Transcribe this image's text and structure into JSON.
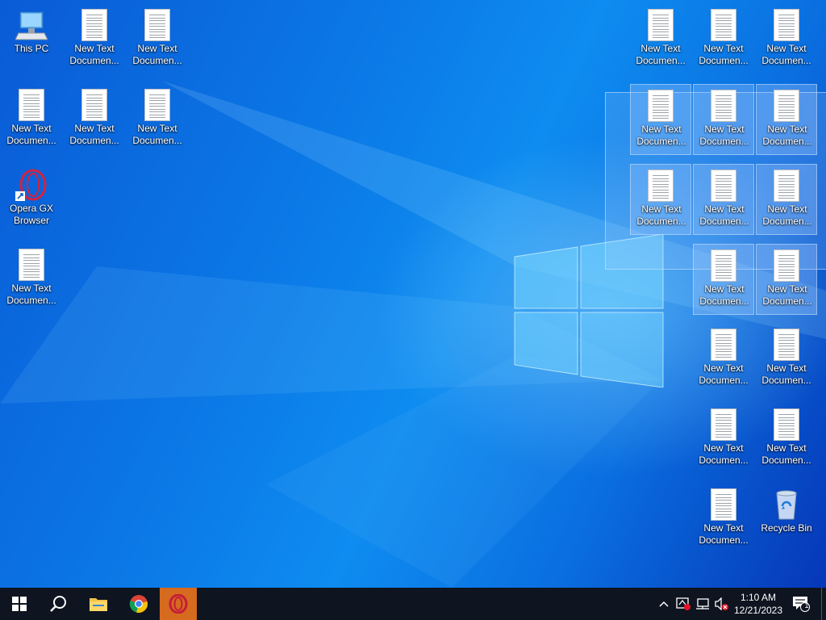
{
  "desktop": {
    "icons": [
      {
        "id": "this-pc",
        "label": "This PC",
        "type": "pc",
        "selected": false
      },
      {
        "id": "doc-1",
        "label": "New Text\nDocumen...",
        "type": "doc",
        "selected": false
      },
      {
        "id": "doc-2",
        "label": "New Text\nDocumen...",
        "type": "doc",
        "selected": false
      },
      {
        "id": "doc-3",
        "label": "New Text\nDocumen...",
        "type": "doc",
        "selected": false
      },
      {
        "id": "doc-4",
        "label": "New Text\nDocumen...",
        "type": "doc",
        "selected": false
      },
      {
        "id": "doc-5",
        "label": "New Text\nDocumen...",
        "type": "doc",
        "selected": false
      },
      {
        "id": "opera-gx",
        "label": "Opera GX\nBrowser",
        "type": "opera",
        "selected": false
      },
      {
        "id": "doc-6",
        "label": "New Text\nDocumen...",
        "type": "doc",
        "selected": false
      },
      {
        "id": "doc-r1",
        "label": "New Text\nDocumen...",
        "type": "doc",
        "selected": false
      },
      {
        "id": "doc-r2",
        "label": "New Text\nDocumen...",
        "type": "doc",
        "selected": false
      },
      {
        "id": "doc-r3",
        "label": "New Text\nDocumen...",
        "type": "doc",
        "selected": false
      },
      {
        "id": "doc-r4",
        "label": "New Text\nDocumen...",
        "type": "doc",
        "selected": true
      },
      {
        "id": "doc-r5",
        "label": "New Text\nDocumen...",
        "type": "doc",
        "selected": true
      },
      {
        "id": "doc-r6",
        "label": "New Text\nDocumen...",
        "type": "doc",
        "selected": true
      },
      {
        "id": "doc-r7",
        "label": "New Text\nDocumen...",
        "type": "doc",
        "selected": true
      },
      {
        "id": "doc-r8",
        "label": "New Text\nDocumen...",
        "type": "doc",
        "selected": true
      },
      {
        "id": "doc-r9",
        "label": "New Text\nDocumen...",
        "type": "doc",
        "selected": true
      },
      {
        "id": "doc-r10",
        "label": "New Text\nDocumen...",
        "type": "doc",
        "selected": true
      },
      {
        "id": "doc-r11",
        "label": "New Text\nDocumen...",
        "type": "doc",
        "selected": true
      },
      {
        "id": "doc-r12",
        "label": "New Text\nDocumen...",
        "type": "doc",
        "selected": false
      },
      {
        "id": "doc-r13",
        "label": "New Text\nDocumen...",
        "type": "doc",
        "selected": false
      },
      {
        "id": "doc-r14",
        "label": "New Text\nDocumen...",
        "type": "doc",
        "selected": false
      },
      {
        "id": "doc-r15",
        "label": "New Text\nDocumen...",
        "type": "doc",
        "selected": false
      },
      {
        "id": "doc-r16",
        "label": "New Text\nDocumen...",
        "type": "doc",
        "selected": false
      },
      {
        "id": "recycle-bin",
        "label": "Recycle Bin",
        "type": "bin",
        "selected": false
      }
    ]
  },
  "taskbar": {
    "start_icon": "windows-start-icon",
    "search_icon": "search-icon",
    "pinned": [
      {
        "id": "file-explorer",
        "icon": "folder-icon"
      },
      {
        "id": "chrome",
        "icon": "chrome-icon"
      },
      {
        "id": "opera-gx",
        "icon": "opera-gx-icon",
        "active": true
      }
    ],
    "tray": {
      "time": "1:10 AM",
      "date": "12/21/2023",
      "notification_count": "1"
    }
  },
  "colors": {
    "taskbar_bg": "#0e1420",
    "opera_active_bg": "#d66a1e",
    "opera_red": "#d3233f",
    "selection": "#a0c8ff"
  }
}
